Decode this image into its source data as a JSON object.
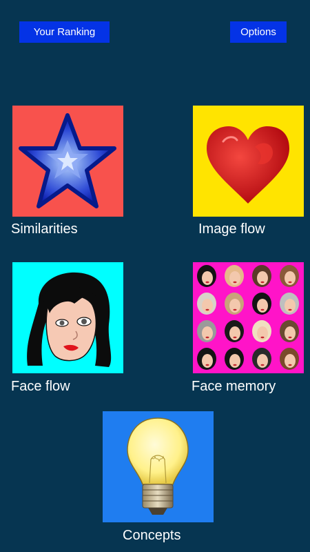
{
  "header": {
    "ranking_label": "Your Ranking",
    "options_label": "Options"
  },
  "games": [
    {
      "label": "Similarities",
      "icon": "star-icon",
      "bg": "#f8524d"
    },
    {
      "label": "Image flow",
      "icon": "heart-icon",
      "bg": "#ffe400"
    },
    {
      "label": "Face flow",
      "icon": "face-icon",
      "bg": "#00ffff"
    },
    {
      "label": "Face memory",
      "icon": "faces-grid-icon",
      "bg": "#ff14c8"
    },
    {
      "label": "Concepts",
      "icon": "lightbulb-icon",
      "bg": "#1f7df0"
    }
  ],
  "colors": {
    "background": "#063551",
    "button": "#0433e6",
    "text": "#ffffff"
  }
}
